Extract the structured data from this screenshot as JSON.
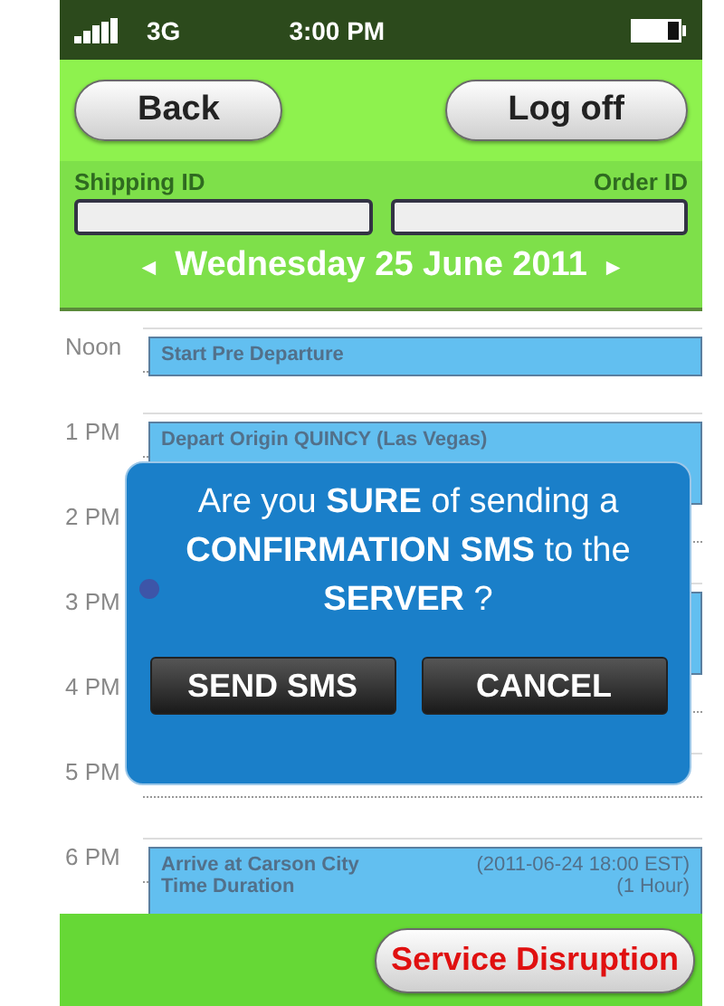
{
  "status_bar": {
    "network": "3G",
    "time": "3:00 PM"
  },
  "nav": {
    "back": "Back",
    "logoff": "Log off"
  },
  "fields": [
    {
      "label": "Shipping ID"
    },
    {
      "label": "Order ID"
    }
  ],
  "date": {
    "prev": "◄",
    "label": "Wednesday 25 June 2011",
    "next": "►"
  },
  "timeline": [
    {
      "label": "Noon",
      "events": [
        {
          "kind": "short",
          "current": false,
          "lines": [
            {
              "left": "Start Pre Departure"
            }
          ]
        }
      ]
    },
    {
      "label": "1 PM",
      "events": [
        {
          "kind": "tall",
          "current": false,
          "lines": [
            {
              "left": "Depart Origin QUINCY (Las Vegas)"
            }
          ]
        }
      ]
    },
    {
      "label": "2 PM"
    },
    {
      "label": "3 PM",
      "events": [
        {
          "kind": "tall",
          "current": true
        }
      ]
    },
    {
      "label": "4 PM"
    },
    {
      "label": "5 PM"
    },
    {
      "label": "6 PM",
      "events": [
        {
          "kind": "tall",
          "current": false,
          "lines": [
            {
              "left": "Arrive at Carson City",
              "right": "(2011-06-24 18:00 EST)"
            },
            {
              "left": "Time Duration",
              "right": "(1 Hour)"
            }
          ]
        }
      ]
    }
  ],
  "dialog": {
    "message": "Are you **SURE** of sending a **CONFIRMATION SMS** to the **SERVER** ?",
    "buttons": [
      "SEND SMS",
      "CANCEL"
    ]
  },
  "footer": {
    "button": "Service Disruption"
  }
}
